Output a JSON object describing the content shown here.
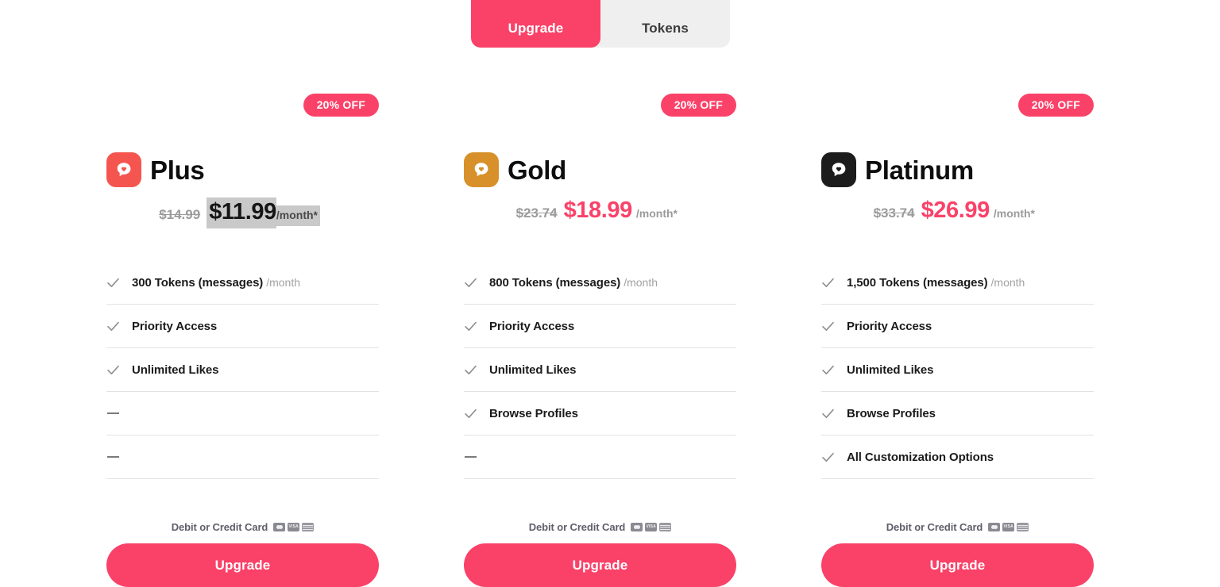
{
  "toggle": {
    "tabs": [
      {
        "label": "Upgrade",
        "active": true
      },
      {
        "label": "Tokens",
        "active": false
      }
    ]
  },
  "colors": {
    "accent_pink": "#fa4269",
    "plus_icon": "#f4564f",
    "gold_icon": "#d8902b",
    "platinum_icon": "#1c1c1c",
    "muted_text": "#9b9b9b",
    "divider": "#e2e2e2",
    "selection_highlight": "#c9c9c9"
  },
  "plans": [
    {
      "badge": "20% OFF",
      "name": "Plus",
      "icon_name": "chat-heart-icon",
      "icon_color": "#f4564f",
      "price_old": "$14.99",
      "price_new": "$11.99",
      "price_unit": "/month*",
      "price_selected": true,
      "features": [
        {
          "available": true,
          "text": "300 Tokens (messages)",
          "sub": "/month"
        },
        {
          "available": true,
          "text": "Priority Access",
          "sub": ""
        },
        {
          "available": true,
          "text": "Unlimited Likes",
          "sub": ""
        },
        {
          "available": false,
          "text": "",
          "sub": ""
        },
        {
          "available": false,
          "text": "",
          "sub": ""
        }
      ],
      "payment_label": "Debit or Credit Card",
      "cta_label": "Upgrade"
    },
    {
      "badge": "20% OFF",
      "name": "Gold",
      "icon_name": "chat-heart-icon",
      "icon_color": "#d8902b",
      "price_old": "$23.74",
      "price_new": "$18.99",
      "price_unit": "/month*",
      "price_selected": false,
      "features": [
        {
          "available": true,
          "text": "800 Tokens (messages)",
          "sub": "/month"
        },
        {
          "available": true,
          "text": "Priority Access",
          "sub": ""
        },
        {
          "available": true,
          "text": "Unlimited Likes",
          "sub": ""
        },
        {
          "available": true,
          "text": "Browse Profiles",
          "sub": ""
        },
        {
          "available": false,
          "text": "",
          "sub": ""
        }
      ],
      "payment_label": "Debit or Credit Card",
      "cta_label": "Upgrade"
    },
    {
      "badge": "20% OFF",
      "name": "Platinum",
      "icon_name": "chat-heart-icon",
      "icon_color": "#1c1c1c",
      "price_old": "$33.74",
      "price_new": "$26.99",
      "price_unit": "/month*",
      "price_selected": false,
      "features": [
        {
          "available": true,
          "text": "1,500 Tokens (messages)",
          "sub": "/month"
        },
        {
          "available": true,
          "text": "Priority Access",
          "sub": ""
        },
        {
          "available": true,
          "text": "Unlimited Likes",
          "sub": ""
        },
        {
          "available": true,
          "text": "Browse Profiles",
          "sub": ""
        },
        {
          "available": true,
          "text": "All Customization Options",
          "sub": ""
        }
      ],
      "payment_label": "Debit or Credit Card",
      "cta_label": "Upgrade"
    }
  ],
  "card_logos": [
    "mastercard-logo",
    "visa-logo",
    "amex-logo"
  ],
  "visa_text": "VISA"
}
